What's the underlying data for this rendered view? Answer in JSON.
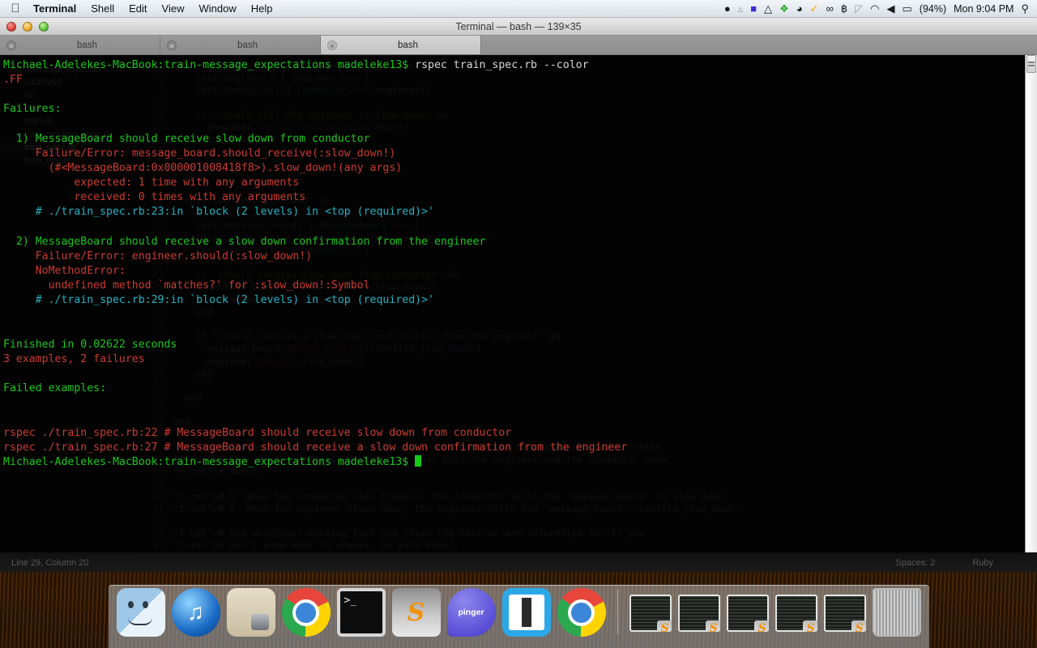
{
  "menubar": {
    "apple": "apple-logo",
    "items": [
      {
        "label": "Terminal",
        "bold": true
      },
      {
        "label": "Shell",
        "bold": false
      },
      {
        "label": "Edit",
        "bold": false
      },
      {
        "label": "View",
        "bold": false
      },
      {
        "label": "Window",
        "bold": false
      },
      {
        "label": "Help",
        "bold": false
      }
    ],
    "status_icons": [
      {
        "name": "chat-bubble-icon",
        "glyph": "●"
      },
      {
        "name": "bell-icon",
        "glyph": "▲"
      },
      {
        "name": "square-app-icon",
        "glyph": "■"
      },
      {
        "name": "google-drive-icon",
        "glyph": "△"
      },
      {
        "name": "dropbox-icon",
        "glyph": "❖"
      },
      {
        "name": "bowler-hat-icon",
        "glyph": "◕"
      },
      {
        "name": "checkmark-circle-icon",
        "glyph": "✓"
      },
      {
        "name": "chain-link-icon",
        "glyph": "∞"
      },
      {
        "name": "bluetooth-icon",
        "glyph": "฿"
      },
      {
        "name": "time-machine-icon",
        "glyph": "◴"
      },
      {
        "name": "wifi-icon",
        "glyph": "◠"
      },
      {
        "name": "volume-icon",
        "glyph": "◀"
      },
      {
        "name": "battery-icon",
        "glyph": "▭"
      }
    ],
    "battery_percent": "(94%)",
    "clock": "Mon 9:04 PM",
    "spotlight": "search-icon"
  },
  "terminal": {
    "window_title": "Terminal — bash — 139×35",
    "traffic_lights": [
      "close-button",
      "minimize-button",
      "zoom-button"
    ],
    "tabs": [
      {
        "label": "bash",
        "active": false
      },
      {
        "label": "bash",
        "active": false
      },
      {
        "label": "bash",
        "active": true
      }
    ],
    "lines": [
      {
        "segments": [
          {
            "t": "Michael-Adelekes-MacBook:train-message_expectations madeleke13$ ",
            "c": "c-green"
          },
          {
            "t": "rspec train_spec.rb --color",
            "c": "c-white"
          }
        ]
      },
      {
        "segments": [
          {
            "t": ".FF",
            "c": "c-red"
          }
        ]
      },
      {
        "segments": [
          {
            "t": "",
            "c": "c-white"
          }
        ]
      },
      {
        "segments": [
          {
            "t": "Failures:",
            "c": "c-green"
          }
        ]
      },
      {
        "segments": [
          {
            "t": "",
            "c": "c-white"
          }
        ]
      },
      {
        "segments": [
          {
            "t": "  1) MessageBoard should receive slow down from conductor",
            "c": "c-green"
          }
        ]
      },
      {
        "segments": [
          {
            "t": "     Failure/Error: message_board.should_receive(:slow_down!)",
            "c": "c-red"
          }
        ]
      },
      {
        "segments": [
          {
            "t": "       (#<MessageBoard:0x000001008418f8>).slow_down!(any args)",
            "c": "c-red"
          }
        ]
      },
      {
        "segments": [
          {
            "t": "           expected: 1 time with any arguments",
            "c": "c-red"
          }
        ]
      },
      {
        "segments": [
          {
            "t": "           received: 0 times with any arguments",
            "c": "c-red"
          }
        ]
      },
      {
        "segments": [
          {
            "t": "     # ./train_spec.rb:23:in `block (2 levels) in <top (required)>'",
            "c": "c-cyan"
          }
        ]
      },
      {
        "segments": [
          {
            "t": "",
            "c": "c-white"
          }
        ]
      },
      {
        "segments": [
          {
            "t": "  2) MessageBoard should receive a slow down confirmation from the engineer",
            "c": "c-green"
          }
        ]
      },
      {
        "segments": [
          {
            "t": "     Failure/Error: engineer.should(:slow_down!)",
            "c": "c-red"
          }
        ]
      },
      {
        "segments": [
          {
            "t": "     NoMethodError:",
            "c": "c-red"
          }
        ]
      },
      {
        "segments": [
          {
            "t": "       undefined method `matches?' for :slow_down!:Symbol",
            "c": "c-red"
          }
        ]
      },
      {
        "segments": [
          {
            "t": "     # ./train_spec.rb:29:in `block (2 levels) in <top (required)>'",
            "c": "c-cyan"
          }
        ]
      },
      {
        "segments": [
          {
            "t": "",
            "c": "c-white"
          }
        ]
      },
      {
        "segments": [
          {
            "t": "",
            "c": "c-white"
          }
        ]
      },
      {
        "segments": [
          {
            "t": "Finished in 0.02622 seconds",
            "c": "c-green"
          }
        ]
      },
      {
        "segments": [
          {
            "t": "3 examples, 2 failures",
            "c": "c-red"
          }
        ]
      },
      {
        "segments": [
          {
            "t": "",
            "c": "c-white"
          }
        ]
      },
      {
        "segments": [
          {
            "t": "Failed examples:",
            "c": "c-green"
          }
        ]
      },
      {
        "segments": [
          {
            "t": "",
            "c": "c-white"
          }
        ]
      },
      {
        "segments": [
          {
            "t": "",
            "c": "c-white"
          }
        ]
      },
      {
        "segments": [
          {
            "t": "rspec ./train_spec.rb:22 # MessageBoard should receive slow down from conductor",
            "c": "c-red"
          }
        ]
      },
      {
        "segments": [
          {
            "t": "rspec ./train_spec.rb:27 # MessageBoard should receive a slow down confirmation from the engineer",
            "c": "c-red"
          }
        ]
      }
    ],
    "prompt": "Michael-Adelekes-MacBook:train-message_expectations madeleke13$ ",
    "cursor": "block-cursor"
  },
  "sublime": {
    "sidebar": {
      "folder": "train-message_expectati",
      "files": [
        {
          "label": "LICENSE",
          "selected": false
        },
        {
          "label": "lor",
          "selected": false
        },
        {
          "label": ".md",
          "selected": false
        },
        {
          "label": "train.rb",
          "selected": false
        },
        {
          "label": "train_minitest_spec.rb",
          "selected": false
        },
        {
          "label": "train_spec.rb",
          "selected": true
        },
        {
          "label": "train_test.rb",
          "selected": false
        }
      ]
    },
    "code": [
      {
        "num": "5",
        "text": ""
      },
      {
        "num": "6",
        "text": "    let(:engineer) { Engineer.new }"
      },
      {
        "num": "7",
        "text": "    let(:conductor) { Conductor.new(engineer)}"
      },
      {
        "num": "8",
        "text": ""
      },
      {
        "num": "9",
        "text": "    it \"should tell the engineer to slow down\" do"
      },
      {
        "num": "10",
        "text": "      engineer.should_receive(:slow_down!)"
      },
      {
        "num": "11",
        "text": "      conductor.see_danger_coming!"
      },
      {
        "num": "12",
        "text": "    end"
      },
      {
        "num": "13",
        "text": ""
      },
      {
        "num": "14",
        "text": "  end"
      },
      {
        "num": "15",
        "text": ""
      },
      {
        "num": "16",
        "text": "  describe 'MessageBoard' do"
      },
      {
        "num": "17",
        "text": ""
      },
      {
        "num": "18",
        "text": "    let(:message_board) { MessageBoard.new }"
      },
      {
        "num": "19",
        "text": "    let(:conductor) { Conductor.new(engineer)}"
      },
      {
        "num": "20",
        "text": "    let(:engineer) { Engineer.new }"
      },
      {
        "num": "21",
        "text": ""
      },
      {
        "num": "22",
        "text": "    it \"should receive slow down from conductor\" do"
      },
      {
        "num": "23",
        "text": "      message_board.should_receive(:slow_down!)"
      },
      {
        "num": "24",
        "text": "      conductor.see_danger_coming!"
      },
      {
        "num": "25",
        "text": "    end"
      },
      {
        "num": "26",
        "text": ""
      },
      {
        "num": "27",
        "text": "    it \"should receive a slow down confirmation from the engineer\" do"
      },
      {
        "num": "28",
        "text": "      message_board.should_receive(:confirm_slow_down!)"
      },
      {
        "num": "29",
        "text": "      engineer.should(:slow_down!)"
      },
      {
        "num": "30",
        "text": "    end"
      },
      {
        "num": "31",
        "text": ""
      },
      {
        "num": "32",
        "text": "  end"
      },
      {
        "num": "33",
        "text": ""
      },
      {
        "num": "34",
        "text": "end"
      },
      {
        "num": "35",
        "text": ""
      },
      {
        "num": "36",
        "text": "# In most circumstances like this, there's a sort of MessageBoard. Let's create"
      },
      {
        "num": "37",
        "text": "# the idea of a MessageBoard class that both the engineer and the conductor know"
      },
      {
        "num": "38",
        "text": "# about."
      },
      {
        "num": "39",
        "text": ""
      },
      {
        "num": "40",
        "text": "# 1. When the conductor sees trouble, the conductor tells the `message_board` to slow down"
      },
      {
        "num": "41",
        "text": "# 2. When the engineer slows down, the engineer tells the `message_board` `confirm_slow_down`"
      },
      {
        "num": "42",
        "text": ""
      },
      {
        "num": "43",
        "text": "# Use whichever mocking tool you liked the best or are interested in. If you"
      },
      {
        "num": "44",
        "text": "# don't know what to choose, go with RSpec."
      }
    ],
    "status": {
      "position": "Line 29, Column 20",
      "indentation": "Spaces: 2",
      "syntax": "Ruby"
    }
  },
  "dock": {
    "items": [
      {
        "name": "finder",
        "cls": "ic-finder",
        "running": true
      },
      {
        "name": "itunes",
        "cls": "ic-itunes",
        "running": true
      },
      {
        "name": "iphoto",
        "cls": "ic-iphoto",
        "running": true
      },
      {
        "name": "google-chrome",
        "cls": "ic-chrome",
        "running": true
      },
      {
        "name": "terminal",
        "cls": "ic-terminal",
        "running": true,
        "inner": true
      },
      {
        "name": "sublime-text",
        "cls": "ic-sublime",
        "running": true
      },
      {
        "name": "pinger",
        "cls": "ic-pinger",
        "running": true
      },
      {
        "name": "brackets",
        "cls": "ic-brackets",
        "running": true,
        "inner": true
      },
      {
        "name": "google-chrome-canary",
        "cls": "ic-chrome",
        "running": true
      }
    ],
    "minimized": [
      {
        "name": "minimized-sublime-window-1"
      },
      {
        "name": "minimized-sublime-window-2"
      },
      {
        "name": "minimized-sublime-window-3"
      },
      {
        "name": "minimized-sublime-window-4"
      },
      {
        "name": "minimized-sublime-window-5"
      }
    ],
    "trash": "trash-can"
  }
}
